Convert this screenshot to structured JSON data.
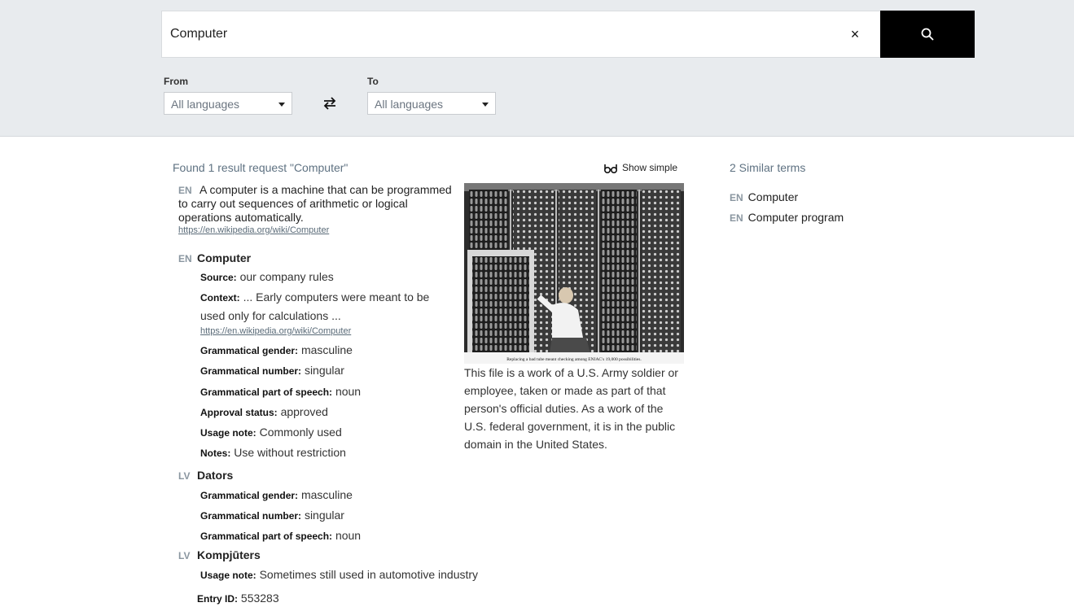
{
  "search": {
    "value": "Computer",
    "clear_icon": "×",
    "button_icon": "search-icon"
  },
  "filters": {
    "from_label": "From",
    "from_value": "All languages",
    "to_label": "To",
    "to_value": "All languages",
    "swap_icon": "swap-arrows-icon"
  },
  "results": {
    "count_text": "Found 1 result request \"Computer\"",
    "show_simple_label": "Show simple",
    "definition": {
      "lang": "EN",
      "text": "A computer is a machine that can be programmed to carry out sequences of arithmetic or logical operations automatically.",
      "link": "https://en.wikipedia.org/wiki/Computer"
    },
    "terms": [
      {
        "lang": "EN",
        "term": "Computer",
        "source_label": "Source:",
        "source": "our company rules",
        "context_label": "Context:",
        "context": "... Early computers were meant to be used only for calculations ...",
        "context_link": "https://en.wikipedia.org/wiki/Computer",
        "gender_label": "Grammatical gender:",
        "gender": "masculine",
        "number_label": "Grammatical number:",
        "number": "singular",
        "pos_label": "Grammatical part of speech:",
        "pos": "noun",
        "approval_label": "Approval status:",
        "approval": "approved",
        "usage_label": "Usage note:",
        "usage": "Commonly used",
        "notes_label": "Notes:",
        "notes": "Use without restriction"
      },
      {
        "lang": "LV",
        "term": "Dators",
        "gender_label": "Grammatical gender:",
        "gender": "masculine",
        "number_label": "Grammatical number:",
        "number": "singular",
        "pos_label": "Grammatical part of speech:",
        "pos": "noun"
      },
      {
        "lang": "LV",
        "term": "Kompjūters",
        "usage_label": "Usage note:",
        "usage": "Sometimes still used in automotive industry"
      }
    ],
    "entry_id_label": "Entry ID:",
    "entry_id": "553283",
    "image": {
      "inline_caption": "Replacing a bad tube meant checking among ENIAC's 19,000 possibilities.",
      "caption": "This file is a work of a U.S. Army soldier or employee, taken or made as part of that person's official duties. As a work of the U.S. federal government, it is in the public domain in the United States."
    }
  },
  "similar": {
    "title": "2 Similar terms",
    "items": [
      {
        "lang": "EN",
        "term": "Computer"
      },
      {
        "lang": "EN",
        "term": "Computer program"
      }
    ]
  }
}
